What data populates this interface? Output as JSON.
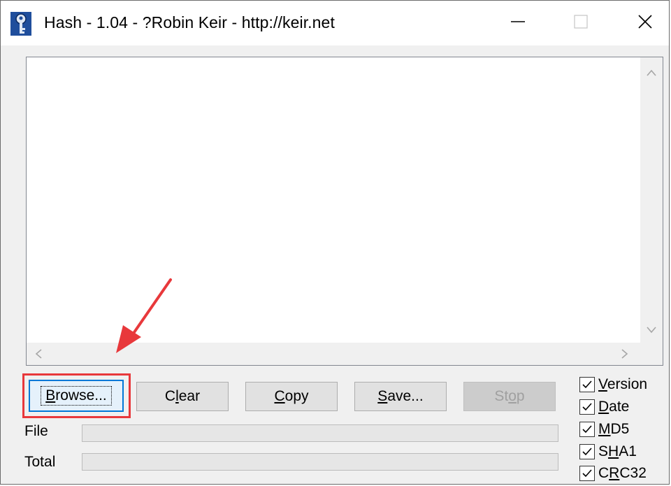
{
  "window": {
    "title": "Hash - 1.04 - ?Robin Keir - http://keir.net"
  },
  "buttons": {
    "browse": {
      "pre": "",
      "u": "B",
      "post": "rowse..."
    },
    "clear": {
      "pre": "C",
      "u": "l",
      "post": "ear"
    },
    "copy": {
      "pre": "",
      "u": "C",
      "post": "opy"
    },
    "save": {
      "pre": "",
      "u": "S",
      "post": "ave..."
    },
    "stop": {
      "pre": "St",
      "u": "o",
      "post": "p"
    }
  },
  "progress": {
    "file_label": "File",
    "total_label": "Total",
    "file_value": 0,
    "total_value": 0
  },
  "options": [
    {
      "pre": "",
      "u": "V",
      "post": "ersion",
      "checked": true
    },
    {
      "pre": "",
      "u": "D",
      "post": "ate",
      "checked": true
    },
    {
      "pre": "",
      "u": "M",
      "post": "D5",
      "checked": true
    },
    {
      "pre": "S",
      "u": "H",
      "post": "A1",
      "checked": true
    },
    {
      "pre": "C",
      "u": "R",
      "post": "C32",
      "checked": true
    }
  ],
  "colors": {
    "highlight": "#e8383b",
    "focus": "#0078d7"
  }
}
